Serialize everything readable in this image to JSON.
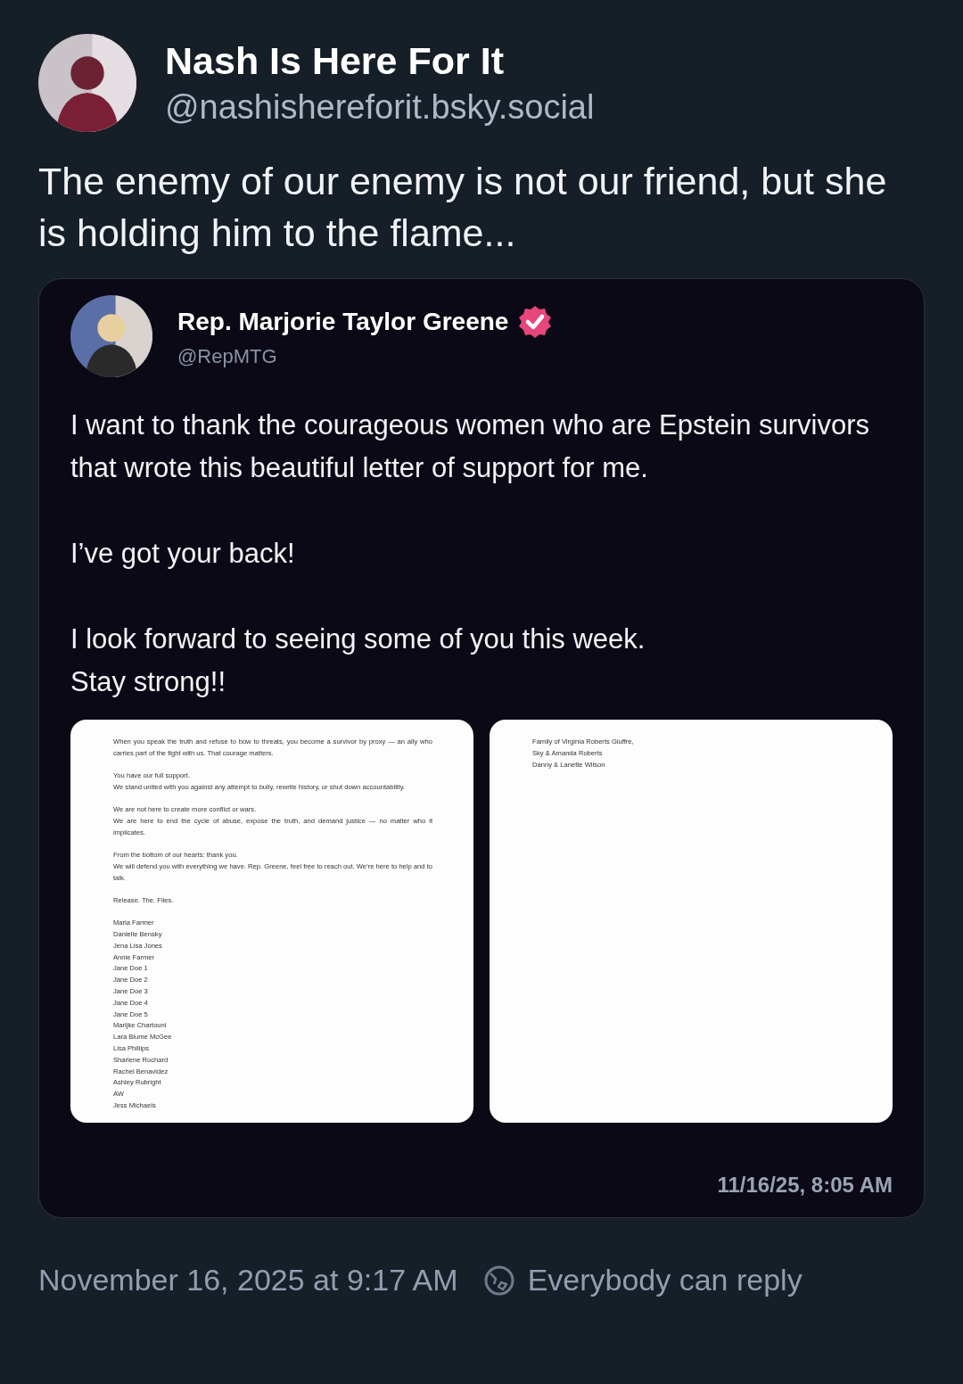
{
  "post": {
    "author_name": "Nash Is Here For It",
    "handle": "@nashishereforit.bsky.social",
    "text": "The enemy of our enemy is not our friend, but she is holding him to the flame..."
  },
  "quote": {
    "author_name": "Rep. Marjorie Taylor Greene",
    "verified": true,
    "handle": "@RepMTG",
    "paragraphs": [
      "I want to thank the courageous women who are Epstein survivors that wrote this beautiful letter of support for me.",
      "I’ve got your back!",
      "I look forward to seeing some of you this week.\nStay strong!!"
    ],
    "documents": [
      {
        "blocks": [
          [
            "When you speak the truth and refuse to bow to threats, you become a survivor by proxy — an ally who carries part of the fight with us. That courage matters."
          ],
          [
            "You have our full support.",
            "We stand united with you against any attempt to bully, rewrite history, or shut down accountability."
          ],
          [
            "We are not here to create more conflict or wars.",
            "We are here to end the cycle of abuse, expose the truth, and demand justice — no matter who it implicates."
          ],
          [
            "From the bottom of our hearts: thank you.",
            "We will defend you with everything we have. Rep. Greene, feel free to reach out. We’re here to help and to talk."
          ],
          [
            "Release. The. Files."
          ],
          [
            "Maria Farmer",
            "Danielle Bensky",
            "Jena Lisa Jones",
            "Annie Farmer",
            "Jane Doe 1",
            "Jane Doe 2",
            "Jane Doe 3",
            "Jane Doe 4",
            "Jane Doe 5",
            "Marijke Chartouni",
            "Lara Blume McGee",
            "Lisa Phillips",
            "Sharlene Rochard",
            "Rachel Benavidez",
            "Ashley Rubright",
            "AW",
            "Jess Michaels"
          ]
        ]
      },
      {
        "blocks": [
          [
            "Family of Virginia Roberts Giuffre,",
            "Sky & Amanda Roberts",
            "Danny & Lanette Wilson"
          ]
        ]
      }
    ],
    "timestamp": "11/16/25, 8:05 AM"
  },
  "footer": {
    "date": "November 16, 2025 at 9:17 AM",
    "reply_setting": "Everybody can reply"
  }
}
